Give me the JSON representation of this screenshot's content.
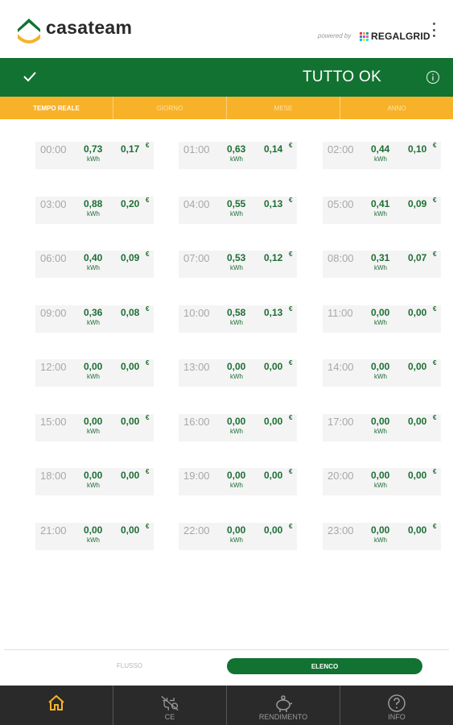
{
  "header": {
    "brand": "casateam",
    "powered_by": "powered by",
    "partner": "REGALGRID",
    "partner_dot_colors": [
      "#e63946",
      "#f4a261",
      "#2a9d8f",
      "#457b9d",
      "#9b5de5",
      "#f15bb5",
      "#00bbf9",
      "#fee440",
      "#00f5d4"
    ],
    "logo_colors": {
      "roof": "#127232",
      "base": "#f7b229"
    }
  },
  "status": {
    "text": "TUTTO OK"
  },
  "tabs": [
    {
      "label": "TEMPO REALE",
      "active": true
    },
    {
      "label": "GIORNO",
      "active": false
    },
    {
      "label": "MESE",
      "active": false
    },
    {
      "label": "ANNO",
      "active": false
    }
  ],
  "units": {
    "energy": "kWh",
    "currency": "€"
  },
  "hours": [
    {
      "time": "00:00",
      "kwh": "0,73",
      "eur": "0,17"
    },
    {
      "time": "01:00",
      "kwh": "0,63",
      "eur": "0,14"
    },
    {
      "time": "02:00",
      "kwh": "0,44",
      "eur": "0,10"
    },
    {
      "time": "03:00",
      "kwh": "0,88",
      "eur": "0,20"
    },
    {
      "time": "04:00",
      "kwh": "0,55",
      "eur": "0,13"
    },
    {
      "time": "05:00",
      "kwh": "0,41",
      "eur": "0,09"
    },
    {
      "time": "06:00",
      "kwh": "0,40",
      "eur": "0,09"
    },
    {
      "time": "07:00",
      "kwh": "0,53",
      "eur": "0,12"
    },
    {
      "time": "08:00",
      "kwh": "0,31",
      "eur": "0,07"
    },
    {
      "time": "09:00",
      "kwh": "0,36",
      "eur": "0,08"
    },
    {
      "time": "10:00",
      "kwh": "0,58",
      "eur": "0,13"
    },
    {
      "time": "11:00",
      "kwh": "0,00",
      "eur": "0,00"
    },
    {
      "time": "12:00",
      "kwh": "0,00",
      "eur": "0,00"
    },
    {
      "time": "13:00",
      "kwh": "0,00",
      "eur": "0,00"
    },
    {
      "time": "14:00",
      "kwh": "0,00",
      "eur": "0,00"
    },
    {
      "time": "15:00",
      "kwh": "0,00",
      "eur": "0,00"
    },
    {
      "time": "16:00",
      "kwh": "0,00",
      "eur": "0,00"
    },
    {
      "time": "17:00",
      "kwh": "0,00",
      "eur": "0,00"
    },
    {
      "time": "18:00",
      "kwh": "0,00",
      "eur": "0,00"
    },
    {
      "time": "19:00",
      "kwh": "0,00",
      "eur": "0,00"
    },
    {
      "time": "20:00",
      "kwh": "0,00",
      "eur": "0,00"
    },
    {
      "time": "21:00",
      "kwh": "0,00",
      "eur": "0,00"
    },
    {
      "time": "22:00",
      "kwh": "0,00",
      "eur": "0,00"
    },
    {
      "time": "23:00",
      "kwh": "0,00",
      "eur": "0,00"
    }
  ],
  "view_toggle": {
    "flusso": "FLUSSO",
    "elenco": "ELENCO",
    "selected": "elenco"
  },
  "bottom_nav": [
    {
      "label": "",
      "icon": "home-icon",
      "active": true
    },
    {
      "label": "CE",
      "icon": "no-plug-icon",
      "active": false
    },
    {
      "label": "RENDIMENTO",
      "icon": "piggy-bank-icon",
      "active": false
    },
    {
      "label": "INFO",
      "icon": "question-icon",
      "active": false
    }
  ],
  "colors": {
    "green": "#127232",
    "yellow": "#f7b229",
    "value_green": "#1d6e34",
    "nav_bg": "#2a2a2a"
  }
}
